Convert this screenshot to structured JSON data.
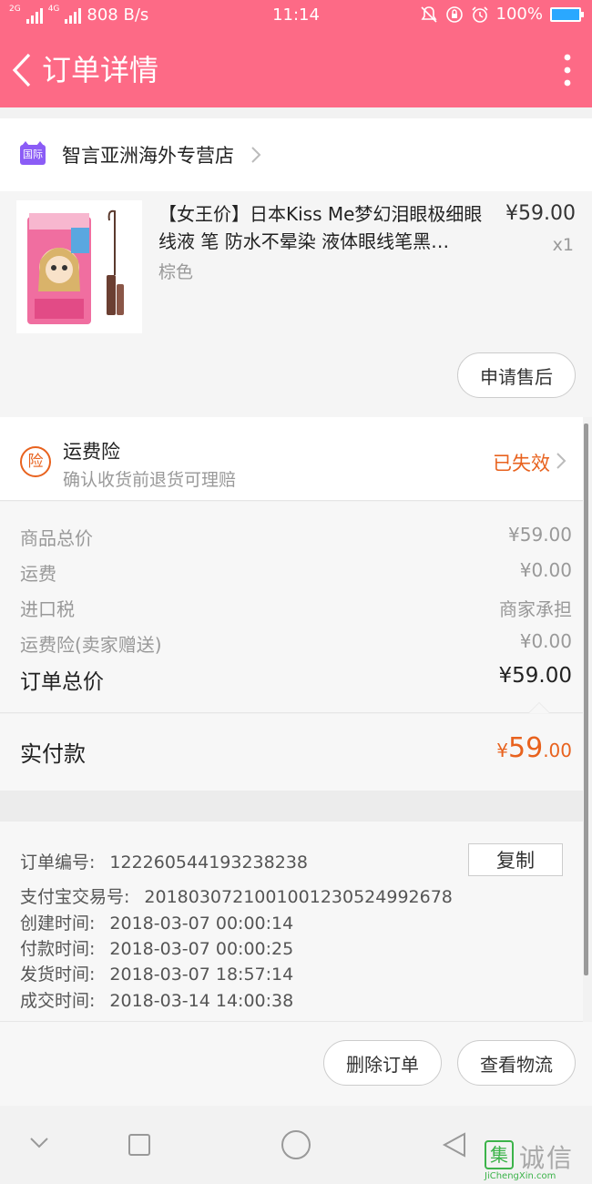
{
  "status_bar": {
    "net_speed": "808 B/s",
    "time": "11:14",
    "battery": "100%",
    "net_labels": [
      "2G",
      "4G"
    ]
  },
  "header": {
    "title": "订单详情"
  },
  "store": {
    "badge": "国际",
    "name": "智言亚洲海外专营店"
  },
  "product": {
    "title": "【女王价】日本Kiss Me梦幻泪眼极细眼线液 笔 防水不晕染 液体眼线笔黑…",
    "sku": "棕色",
    "price": "¥59.00",
    "qty": "x1",
    "aftersale_label": "申请售后"
  },
  "insurance": {
    "icon_text": "险",
    "title": "运费险",
    "subtitle": "确认收货前退货可理赔",
    "status": "已失效"
  },
  "summary": {
    "rows": [
      {
        "label": "商品总价",
        "value": "¥59.00"
      },
      {
        "label": "运费",
        "value": "¥0.00"
      },
      {
        "label": "进口税",
        "value": "商家承担"
      },
      {
        "label": "运费险(卖家赠送)",
        "value": "¥0.00"
      }
    ],
    "total_label": "订单总价",
    "total_value": "¥59.00"
  },
  "paid": {
    "label": "实付款",
    "currency": "¥",
    "integer": "59",
    "decimal": ".00"
  },
  "order_info": {
    "copy_label": "复制",
    "rows": [
      {
        "label": "订单编号:",
        "value": "122260544193238238"
      },
      {
        "label": "支付宝交易号:",
        "value": "2018030721001001230524992678"
      },
      {
        "label": "创建时间:",
        "value": "2018-03-07 00:00:14"
      },
      {
        "label": "付款时间:",
        "value": "2018-03-07 00:00:25"
      },
      {
        "label": "发货时间:",
        "value": "2018-03-07 18:57:14"
      },
      {
        "label": "成交时间:",
        "value": "2018-03-14 14:00:38"
      }
    ]
  },
  "actions": {
    "delete_label": "删除订单",
    "logistics_label": "查看物流"
  },
  "watermark": {
    "logo": "集",
    "text": "诚信",
    "sub": "JiChengXin.com"
  },
  "colors": {
    "brand": "#fd6a86",
    "accent": "#e8621e"
  }
}
